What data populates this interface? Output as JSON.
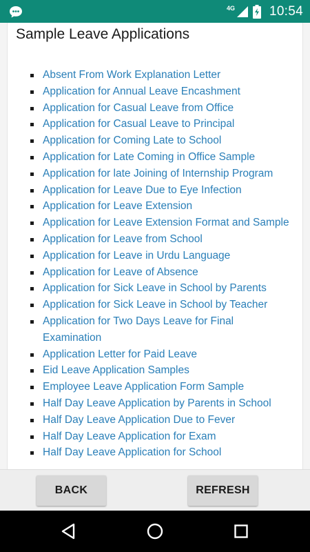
{
  "status_bar": {
    "network": "4G",
    "time": "10:54"
  },
  "page": {
    "title": "Sample Leave Applications"
  },
  "links": [
    "Absent From Work Explanation Letter",
    "Application for Annual Leave Encashment",
    "Application for Casual Leave from Office",
    "Application for Casual Leave to Principal",
    "Application for Coming Late to School",
    "Application for Late Coming in Office Sample",
    "Application for late Joining of Internship Program",
    "Application for Leave Due to Eye Infection",
    "Application for Leave Extension",
    "Application for Leave Extension Format and Sample",
    "Application for Leave from School",
    "Application for Leave in Urdu Language",
    "Application for Leave of Absence",
    "Application for Sick Leave in School by Parents",
    "Application for Sick Leave in School by Teacher",
    "Application for Two Days Leave for Final Examination",
    "Application Letter for Paid Leave",
    "Eid Leave Application Samples",
    "Employee Leave Application Form Sample",
    "Half Day Leave Application by Parents in School",
    "Half Day Leave Application Due to Fever",
    "Half Day Leave Application for Exam",
    "Half Day Leave Application for School"
  ],
  "buttons": {
    "back": "BACK",
    "refresh": "REFRESH"
  },
  "colors": {
    "status_bar": "#0f8a78",
    "link": "#2a7fb8"
  },
  "icons": {
    "status_left": "chat-bubble-icon",
    "signal": "signal-icon",
    "battery": "battery-charging-icon",
    "nav_back": "triangle-back-icon",
    "nav_home": "circle-home-icon",
    "nav_recents": "square-recents-icon"
  }
}
